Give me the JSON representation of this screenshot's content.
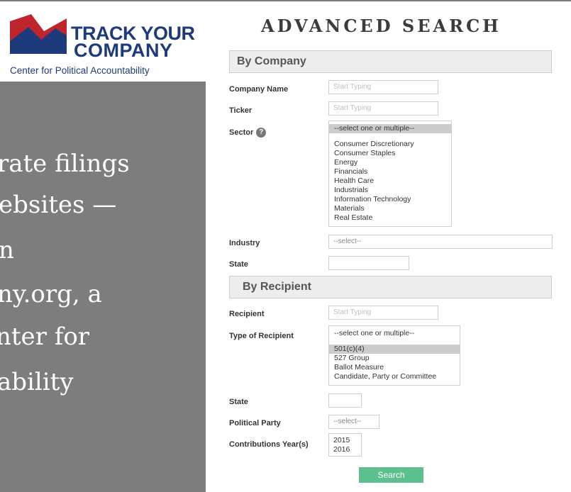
{
  "logo": {
    "line1": "TRACK YOUR",
    "line2": "COMPANY",
    "subtitle": "Center for Political Accountability",
    "brand_red": "#c0252e",
    "brand_blue": "#1d3a7a"
  },
  "side_panel": {
    "lines": [
      "rate filings",
      "ebsites —",
      "n",
      "ny.org, a",
      "nter for",
      "ability"
    ]
  },
  "form": {
    "title": "ADVANCED SEARCH",
    "by_company": {
      "heading": "By Company",
      "company_name_label": "Company Name",
      "company_name_placeholder": "Start Typing",
      "ticker_label": "Ticker",
      "ticker_placeholder": "Start Typing",
      "sector_label": "Sector",
      "sector_help": "?",
      "sector_options": [
        "--select one or multiple--",
        "Consumer Discretionary",
        "Consumer Staples",
        "Energy",
        "Financials",
        "Health Care",
        "Industrials",
        "Information Technology",
        "Materials",
        "Real Estate"
      ],
      "industry_label": "Industry",
      "industry_value": "--select--",
      "state_label": "State",
      "state_value": ""
    },
    "by_recipient": {
      "heading": "By Recipient",
      "recipient_label": "Recipient",
      "recipient_placeholder": "Start Typing",
      "type_label": "Type of Recipient",
      "type_options": [
        "--select one or multiple--",
        "501(c)(4)",
        "527 Group",
        "Ballot Measure",
        "Candidate, Party or Committee"
      ],
      "state_label": "State",
      "state_value": "",
      "party_label": "Political Party",
      "party_value": "--select--",
      "years_label": "Contributions Year(s)",
      "years_options": [
        "2015",
        "2016"
      ]
    },
    "search_label": "Search",
    "search_color": "#5dbf8d"
  }
}
